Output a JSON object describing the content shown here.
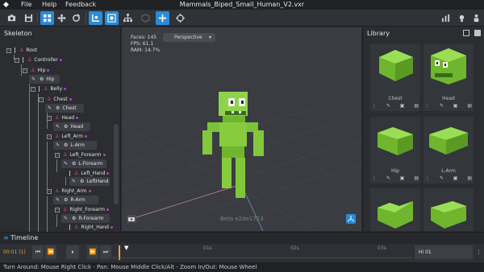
{
  "menubar": {
    "items": [
      "File",
      "Help",
      "Feedback"
    ],
    "title": "Mammals_Biped_Small_Human_V2.vxr"
  },
  "toolbar": {
    "icons": [
      "camera-icon",
      "save-icon",
      "select-icon",
      "move-icon",
      "rotate-icon",
      "bones-icon",
      "bone-edit-icon",
      "hierarchy-icon",
      "cube-icon",
      "add-icon",
      "target-icon",
      "chart-icon",
      "light-icon",
      "person-icon"
    ]
  },
  "skeleton": {
    "title": "Skeleton",
    "nodes": [
      {
        "name": "Root"
      },
      {
        "name": "Controller"
      },
      {
        "name": "Hip",
        "part": "Hip"
      },
      {
        "name": "Belly"
      },
      {
        "name": "Chest",
        "part": "Chest"
      },
      {
        "name": "Head",
        "part": "Head"
      },
      {
        "name": "Left_Arm",
        "part": "L-Arm"
      },
      {
        "name": "Left_Forearm",
        "part": "L-Forearm"
      },
      {
        "name": "Left_Hand",
        "part": "LeftHand"
      },
      {
        "name": "Right_Arm",
        "part": "R-Arm"
      },
      {
        "name": "Right_Forearm",
        "part": "R-Forearm"
      },
      {
        "name": "Right_Hand"
      }
    ]
  },
  "viewport": {
    "faces": "Faces: 145",
    "fps": "FPS: 61.1",
    "ram": "RAM: 14.7%",
    "mode": "Perspective",
    "watermark": "Beta e2de1723"
  },
  "library": {
    "title": "Library",
    "cards": [
      {
        "label": "Chest",
        "color": "#7fc832"
      },
      {
        "label": "Head",
        "color": "#7fc832"
      },
      {
        "label": "Hip",
        "color": "#7fc832"
      },
      {
        "label": "L-Arm",
        "color": "#7fc832"
      },
      {
        "label": "",
        "color": "#7fc832"
      },
      {
        "label": "",
        "color": "#7fc832"
      }
    ]
  },
  "timeline": {
    "title": "Timeline",
    "time": "00:01 (1)",
    "ticks": [
      "01s",
      "02s",
      "03s"
    ],
    "clip": "Hi 01"
  },
  "status": {
    "text": "Turn Around: Mouse Right Click - Pan: Mouse Middle Click/Alt - Zoom In/Out: Mouse Wheel"
  },
  "colors": {
    "accent": "#2a8bd6",
    "bone": "#e0507a",
    "model": "#7fc832",
    "time": "#e8a630"
  }
}
